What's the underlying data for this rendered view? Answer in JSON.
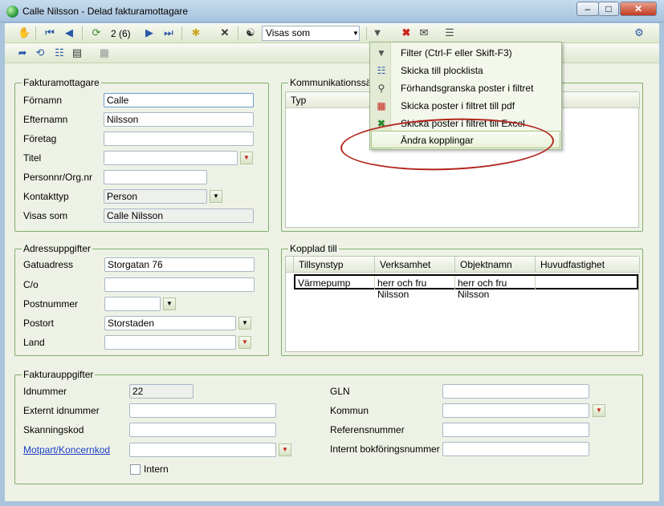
{
  "window": {
    "title": "Calle Nilsson - Delad fakturamottagare"
  },
  "toolbar": {
    "record_position": "2 (6)",
    "view_select": "Visas som"
  },
  "menu": {
    "items": [
      {
        "label": "Filter (Ctrl-F eller Skift-F3)",
        "icon": "filter-icon"
      },
      {
        "label": "Skicka till plocklista",
        "icon": "picklist-icon"
      },
      {
        "label": "Förhandsgranska poster i filtret",
        "icon": "preview-icon"
      },
      {
        "label": "Skicka poster i filtret till pdf",
        "icon": "pdf-icon"
      },
      {
        "label": "Skicka poster i filtret till Excel",
        "icon": "excel-icon"
      },
      {
        "label": "Ändra kopplingar",
        "icon": ""
      }
    ]
  },
  "fakturamottagare": {
    "title": "Fakturamottagare",
    "labels": {
      "fornamn": "Förnamn",
      "efternamn": "Efternamn",
      "foretag": "Företag",
      "titel": "Titel",
      "personnr": "Personnr/Org.nr",
      "kontakttyp": "Kontakttyp",
      "visas_som": "Visas som"
    },
    "values": {
      "fornamn": "Calle",
      "efternamn": "Nilsson",
      "foretag": "",
      "titel": "",
      "personnr": "",
      "kontakttyp": "Person",
      "visas_som": "Calle Nilsson"
    }
  },
  "kommunikation": {
    "title": "Kommunikationssätt",
    "column": "Typ"
  },
  "adress": {
    "title": "Adressuppgifter",
    "labels": {
      "gatuadress": "Gatuadress",
      "co": "C/o",
      "postnummer": "Postnummer",
      "postort": "Postort",
      "land": "Land"
    },
    "values": {
      "gatuadress": "Storgatan 76",
      "co": "",
      "postnummer": "",
      "postort": "Storstaden",
      "land": ""
    }
  },
  "kopplad": {
    "title": "Kopplad till",
    "columns": [
      "Tillsynstyp",
      "Verksamhet",
      "Objektnamn",
      "Huvudfastighet"
    ],
    "rows": [
      [
        "Värmepump",
        "herr och fru Nilsson",
        "herr och fru Nilsson",
        ""
      ]
    ]
  },
  "faktura": {
    "title": "Fakturauppgifter",
    "labels": {
      "idnummer": "Idnummer",
      "externt": "Externt idnummer",
      "skanning": "Skanningskod",
      "motpart": "Motpart/Koncernkod",
      "intern": "Intern",
      "gln": "GLN",
      "kommun": "Kommun",
      "referens": "Referensnummer",
      "bokforing": "Internt bokföringsnummer"
    },
    "values": {
      "idnummer": "22"
    }
  }
}
